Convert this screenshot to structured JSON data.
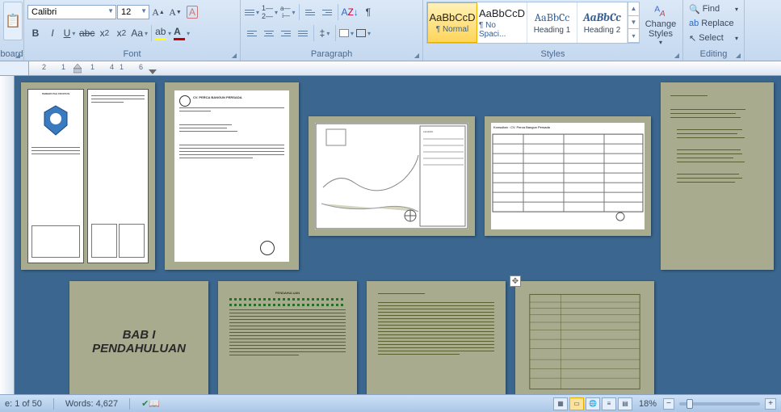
{
  "font": {
    "name": "Calibri",
    "size": "12",
    "group_label": "Font"
  },
  "paragraph": {
    "group_label": "Paragraph"
  },
  "styles": {
    "group_label": "Styles",
    "items": [
      {
        "sample": "AaBbCcD",
        "name": "¶ Normal"
      },
      {
        "sample": "AaBbCcD",
        "name": "¶ No Spaci..."
      },
      {
        "sample": "AaBbCc",
        "name": "Heading 1"
      },
      {
        "sample": "AaBbCc",
        "name": "Heading 2"
      }
    ],
    "change_label": "Change Styles"
  },
  "editing": {
    "group_label": "Editing",
    "find": "Find",
    "replace": "Replace",
    "select": "Select"
  },
  "clipboard": {
    "group_label": "board"
  },
  "ruler": {
    "marks": [
      "2",
      "1",
      "",
      "1",
      "4",
      "1",
      "6"
    ]
  },
  "pages": {
    "p1_header": "PEMERINTAH PROPINSI",
    "p2_title": "CV. PERCA BANGUN PERSADA",
    "p4_title": "Konsultan : CV. Perca Bangun Persada",
    "bab_line1": "BAB I",
    "bab_line2": "PENDAHULUAN",
    "p7_heading": "PENDAHULUAN"
  },
  "status": {
    "page": "e: 1 of 50",
    "words": "Words: 4,627",
    "zoom": "18%",
    "zoom_value": 18
  }
}
